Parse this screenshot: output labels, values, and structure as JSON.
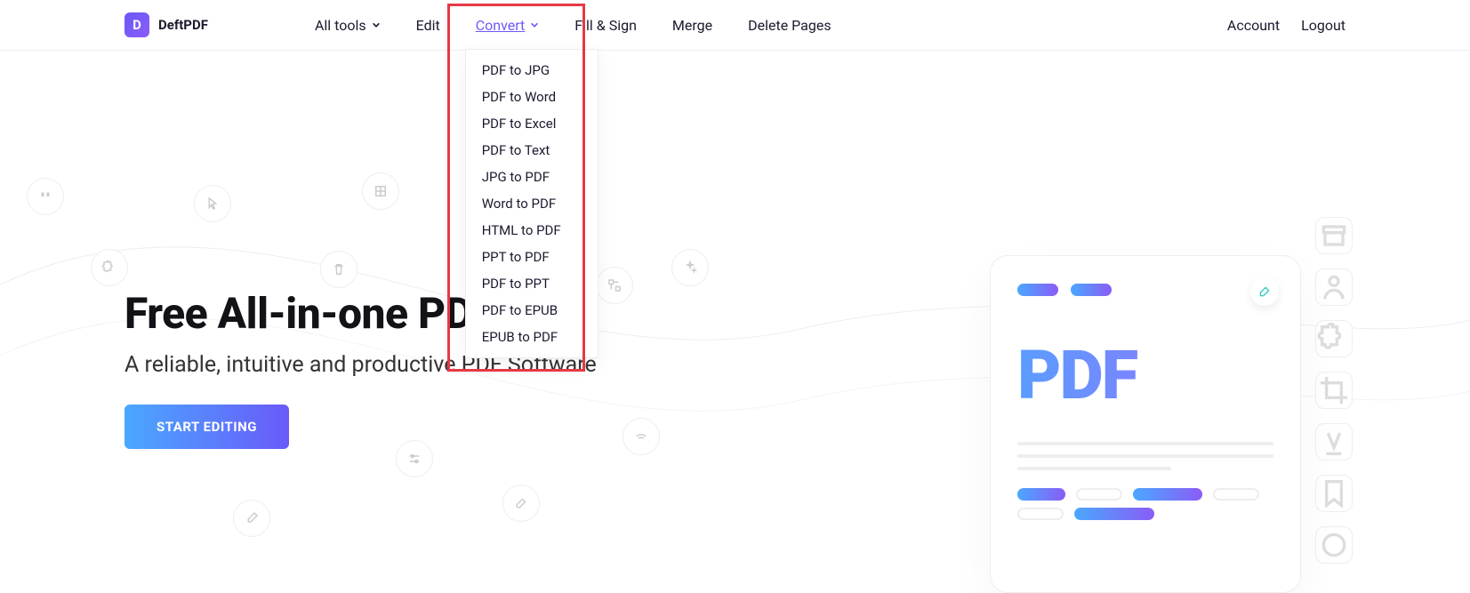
{
  "brand": {
    "letter": "D",
    "name": "DeftPDF"
  },
  "nav": {
    "alltools": "All tools",
    "edit": "Edit",
    "convert": "Convert",
    "fillsign": "Fill & Sign",
    "merge": "Merge",
    "delete": "Delete Pages"
  },
  "convert_menu": [
    "PDF to JPG",
    "PDF to Word",
    "PDF to Excel",
    "PDF to Text",
    "JPG to PDF",
    "Word to PDF",
    "HTML to PDF",
    "PPT to PDF",
    "PDF to PPT",
    "PDF to EPUB",
    "EPUB to PDF"
  ],
  "account": {
    "account": "Account",
    "logout": "Logout"
  },
  "hero": {
    "title": "Free All-in-one PDF tools",
    "subtitle": "A reliable, intuitive and productive PDF Software",
    "cta": "START EDITING",
    "doc_label": "PDF"
  }
}
